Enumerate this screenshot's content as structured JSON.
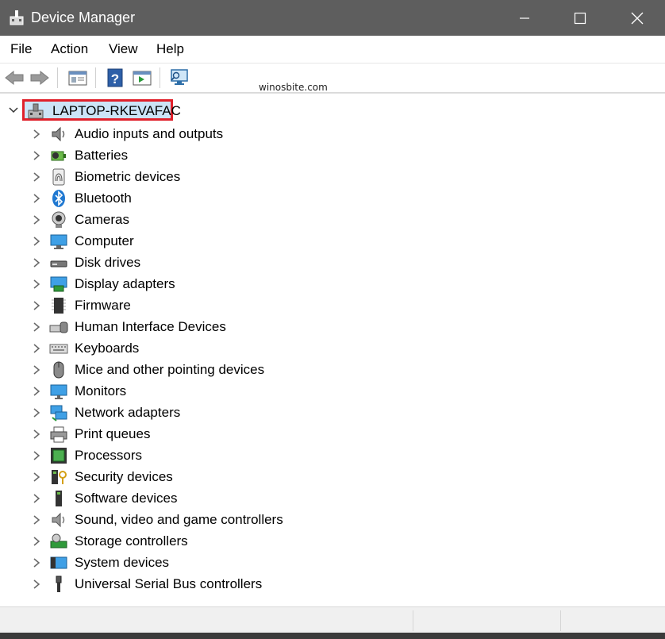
{
  "window": {
    "title": "Device Manager",
    "minimize_icon": "minimize-icon",
    "maximize_icon": "maximize-icon",
    "close_icon": "close-icon"
  },
  "menu": [
    "File",
    "Action",
    "View",
    "Help"
  ],
  "toolbar": {
    "buttons": [
      "back-arrow-icon",
      "forward-arrow-icon",
      "properties-icon",
      "help-icon",
      "run-icon",
      "scan-hardware-icon"
    ]
  },
  "watermark": "winosbite.com",
  "tree": {
    "root": {
      "label": "LAPTOP-RKEVAFAC",
      "expanded": true,
      "highlight_color": "#e0202a"
    },
    "nodes": [
      {
        "label": "Audio inputs and outputs",
        "icon": "speaker-icon"
      },
      {
        "label": "Batteries",
        "icon": "battery-icon"
      },
      {
        "label": "Biometric devices",
        "icon": "fingerprint-icon"
      },
      {
        "label": "Bluetooth",
        "icon": "bluetooth-icon"
      },
      {
        "label": "Cameras",
        "icon": "camera-icon"
      },
      {
        "label": "Computer",
        "icon": "computer-icon"
      },
      {
        "label": "Disk drives",
        "icon": "disk-drive-icon"
      },
      {
        "label": "Display adapters",
        "icon": "display-adapter-icon"
      },
      {
        "label": "Firmware",
        "icon": "firmware-icon"
      },
      {
        "label": "Human Interface Devices",
        "icon": "hid-icon"
      },
      {
        "label": "Keyboards",
        "icon": "keyboard-icon"
      },
      {
        "label": "Mice and other pointing devices",
        "icon": "mouse-icon"
      },
      {
        "label": "Monitors",
        "icon": "monitor-icon"
      },
      {
        "label": "Network adapters",
        "icon": "network-adapter-icon"
      },
      {
        "label": "Print queues",
        "icon": "printer-icon"
      },
      {
        "label": "Processors",
        "icon": "processor-icon"
      },
      {
        "label": "Security devices",
        "icon": "security-device-icon"
      },
      {
        "label": "Software devices",
        "icon": "software-device-icon"
      },
      {
        "label": "Sound, video and game controllers",
        "icon": "sound-icon"
      },
      {
        "label": "Storage controllers",
        "icon": "storage-controller-icon"
      },
      {
        "label": "System devices",
        "icon": "system-device-icon"
      },
      {
        "label": "Universal Serial Bus controllers",
        "icon": "usb-icon"
      }
    ]
  }
}
